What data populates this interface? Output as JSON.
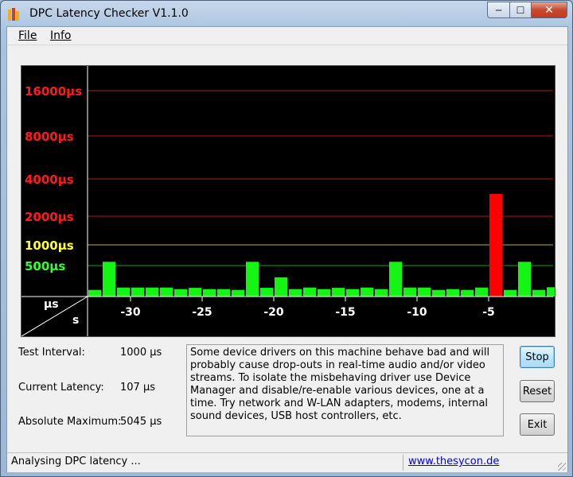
{
  "window": {
    "title": "DPC Latency Checker V1.1.0",
    "caption_min": "─",
    "caption_max": "☐",
    "caption_close": "✕"
  },
  "menu": {
    "file": "File",
    "info": "Info"
  },
  "chart_data": {
    "type": "bar",
    "ylabel": "µs",
    "xlabel": "s",
    "y_ticks": [
      {
        "label": "16000µs",
        "value": 16000,
        "color": "#ff1a1a"
      },
      {
        "label": "8000µs",
        "value": 8000,
        "color": "#ff1a1a"
      },
      {
        "label": "4000µs",
        "value": 4000,
        "color": "#ff1a1a"
      },
      {
        "label": "2000µs",
        "value": 2000,
        "color": "#ff1a1a"
      },
      {
        "label": "1000µs",
        "value": 1000,
        "color": "#ffff33"
      },
      {
        "label": "500µs",
        "value": 500,
        "color": "#33ff33"
      }
    ],
    "x_ticks": [
      -30,
      -25,
      -20,
      -15,
      -10,
      -5
    ],
    "xlim": [
      -33,
      -0.5
    ],
    "bar_values": [
      107,
      590,
      145,
      145,
      145,
      145,
      120,
      140,
      120,
      120,
      107,
      590,
      140,
      310,
      120,
      145,
      120,
      140,
      120,
      145,
      120,
      590,
      145,
      145,
      107,
      120,
      107,
      145,
      3200,
      107,
      590,
      107,
      150
    ],
    "bar_x": [
      -32.5,
      -31.5,
      -30.5,
      -29.5,
      -28.5,
      -27.5,
      -26.5,
      -25.5,
      -24.5,
      -23.5,
      -22.5,
      -21.5,
      -20.5,
      -19.5,
      -18.5,
      -17.5,
      -16.5,
      -15.5,
      -14.5,
      -13.5,
      -12.5,
      -11.5,
      -10.5,
      -9.5,
      -8.5,
      -7.5,
      -6.5,
      -5.5,
      -4.5,
      -3.5,
      -2.5,
      -1.5,
      -0.5
    ],
    "colors": {
      "green": "#14f514",
      "red": "#ff0000",
      "yellow": "#ffff33",
      "background": "#000000",
      "axis": "#ffffff"
    }
  },
  "info": {
    "test_interval_label": "Test Interval:",
    "test_interval_value": "1000 µs",
    "current_latency_label": "Current Latency:",
    "current_latency_value": "107 µs",
    "absolute_max_label": "Absolute Maximum:",
    "absolute_max_value": "5045 µs"
  },
  "message": "Some device drivers on this machine behave bad and will probably cause drop-outs in real-time audio and/or video streams. To isolate the misbehaving driver use Device Manager and disable/re-enable various devices, one at a time. Try network and W-LAN adapters, modems, internal sound devices, USB host controllers, etc.",
  "buttons": {
    "stop": "Stop",
    "reset": "Reset",
    "exit": "Exit"
  },
  "status": {
    "text": "Analysing DPC latency ...",
    "link": "www.thesycon.de"
  }
}
